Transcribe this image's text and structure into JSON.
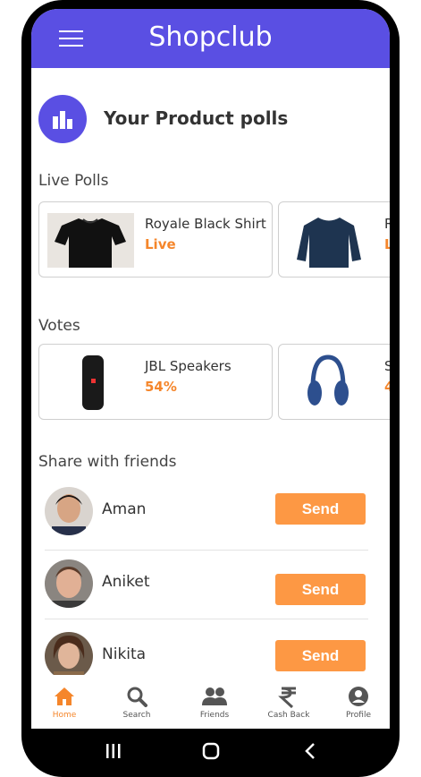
{
  "app": {
    "title": "Shopclub"
  },
  "polls_header": {
    "title": "Your Product polls"
  },
  "live_polls": {
    "label": "Live Polls",
    "items": [
      {
        "name": "Royale Black Shirt",
        "status": "Live"
      },
      {
        "name": "R",
        "status": "L"
      }
    ]
  },
  "votes": {
    "label": "Votes",
    "items": [
      {
        "name": "JBL Speakers",
        "percent": "54%"
      },
      {
        "name": "S",
        "percent": "4"
      }
    ]
  },
  "share": {
    "label": "Share with friends",
    "friends": [
      {
        "name": "Aman",
        "action": "Send"
      },
      {
        "name": "Aniket",
        "action": "Send"
      },
      {
        "name": "Nikita",
        "action": "Send"
      }
    ]
  },
  "tabs": [
    {
      "label": "Home",
      "icon": "home-icon",
      "active": true
    },
    {
      "label": "Search",
      "icon": "search-icon"
    },
    {
      "label": "Friends",
      "icon": "friends-icon"
    },
    {
      "label": "Cash Back",
      "icon": "rupee-icon"
    },
    {
      "label": "Profile",
      "icon": "profile-icon"
    }
  ],
  "colors": {
    "primary": "#5a4fe3",
    "accent": "#f5862b",
    "button": "#fd9844"
  }
}
